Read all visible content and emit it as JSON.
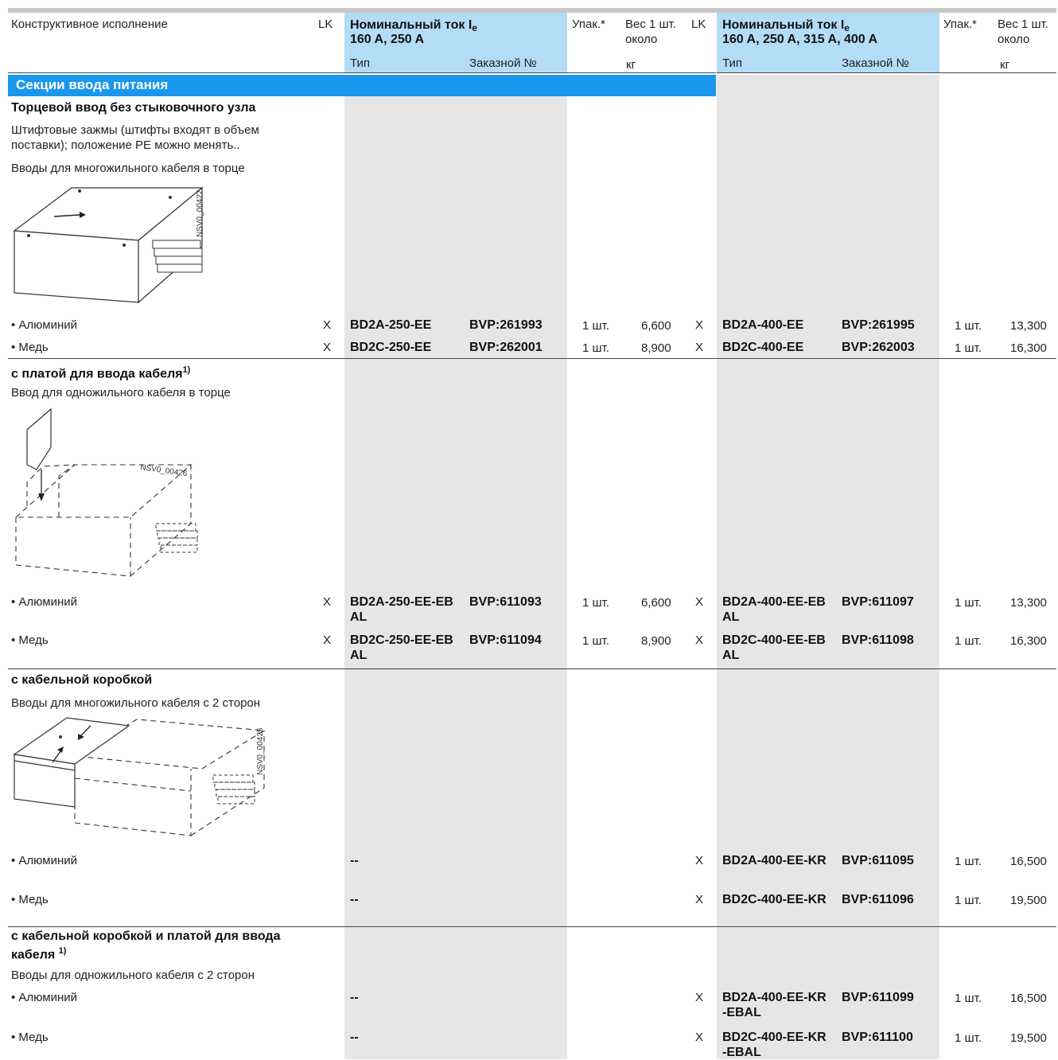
{
  "header": {
    "col_design": "Конструктивное исполнение",
    "lk": "LK",
    "left_current_title": "Номинальный ток I",
    "left_current_sub": "e",
    "left_current_values": "160 A, 250 A",
    "right_current_title": "Номинальный ток I",
    "right_current_sub": "e",
    "right_current_values": "160 A, 250 A, 315 A, 400 A",
    "pack": "Упак.*",
    "weight_line1": "Вес 1 шт.",
    "weight_line2": "около",
    "type": "Тип",
    "order_no": "Заказной №",
    "kg": "кг"
  },
  "section_title": "Секции ввода питания",
  "groups": [
    {
      "title": "Торцевой ввод без стыковочного узла",
      "desc1": "Штифтовые зажмы (штифты входят в объем поставки); положение PE можно менять..",
      "desc2": "Вводы для многожильного кабеля в торце",
      "image_label": "NSV0_00422",
      "rows": [
        {
          "label": "• Алюминий",
          "lk1": "X",
          "type1": "BD2A-250-EE",
          "order1": "BVP:261993",
          "pack1": "1 шт.",
          "w1": "6,600",
          "lk2": "X",
          "type2": "BD2A-400-EE",
          "order2": "BVP:261995",
          "pack2": "1 шт.",
          "w2": "13,300"
        },
        {
          "label": "• Медь",
          "lk1": "X",
          "type1": "BD2C-250-EE",
          "order1": "BVP:262001",
          "pack1": "1 шт.",
          "w1": "8,900",
          "lk2": "X",
          "type2": "BD2C-400-EE",
          "order2": "BVP:262003",
          "pack2": "1 шт.",
          "w2": "16,300"
        }
      ]
    },
    {
      "title": "с платой для ввода кабеля",
      "footnote": "1)",
      "desc1": "Ввод для одножильного кабеля в торце",
      "image_label": "NSV0_00426",
      "rows": [
        {
          "label": "• Алюминий",
          "lk1": "X",
          "type1": "BD2A-250-EE-EBAL",
          "order1": "BVP:611093",
          "pack1": "1 шт.",
          "w1": "6,600",
          "lk2": "X",
          "type2": "BD2A-400-EE-EBAL",
          "order2": "BVP:611097",
          "pack2": "1 шт.",
          "w2": "13,300"
        },
        {
          "label": "• Медь",
          "lk1": "X",
          "type1": "BD2C-250-EE-EBAL",
          "order1": "BVP:611094",
          "pack1": "1 шт.",
          "w1": "8,900",
          "lk2": "X",
          "type2": "BD2C-400-EE-EBAL",
          "order2": "BVP:611098",
          "pack2": "1 шт.",
          "w2": "16,300"
        }
      ]
    },
    {
      "title": "с кабельной коробкой",
      "desc1": "Вводы для многожильного кабеля с 2 сторон",
      "image_label": "NSV0_00425",
      "rows": [
        {
          "label": "• Алюминий",
          "type1": "--",
          "lk2": "X",
          "type2": "BD2A-400-EE-KR",
          "order2": "BVP:611095",
          "pack2": "1 шт.",
          "w2": "16,500"
        },
        {
          "label": "• Медь",
          "type1": "--",
          "lk2": "X",
          "type2": "BD2C-400-EE-KR",
          "order2": "BVP:611096",
          "pack2": "1 шт.",
          "w2": "19,500"
        }
      ]
    },
    {
      "title": "с кабельной коробкой и платой для ввода кабеля",
      "footnote": "1)",
      "desc1": "Вводы для одножильного кабеля с 2 сторон",
      "rows": [
        {
          "label": "• Алюминий",
          "type1": "--",
          "lk2": "X",
          "type2": "BD2A-400-EE-KR-EBAL",
          "order2": "BVP:611099",
          "pack2": "1 шт.",
          "w2": "16,500"
        },
        {
          "label": "• Медь",
          "type1": "--",
          "lk2": "X",
          "type2": "BD2C-400-EE-KR-EBAL",
          "order2": "BVP:611100",
          "pack2": "1 шт.",
          "w2": "19,500"
        }
      ]
    }
  ]
}
